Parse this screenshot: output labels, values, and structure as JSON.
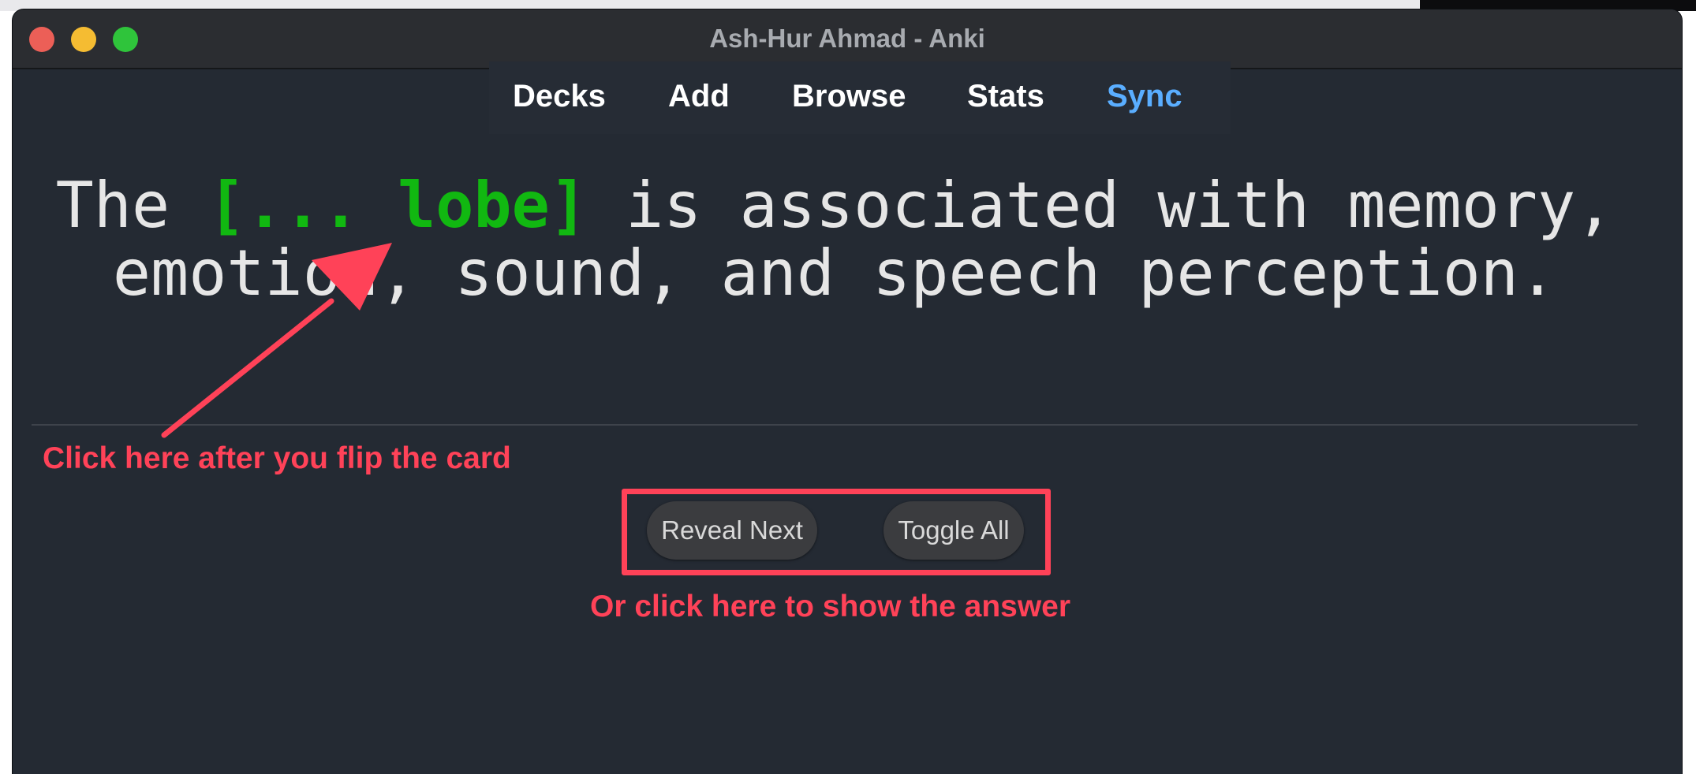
{
  "window": {
    "title": "Ash-Hur Ahmad - Anki"
  },
  "toolbar": {
    "items": [
      {
        "label": "Decks"
      },
      {
        "label": "Add"
      },
      {
        "label": "Browse"
      },
      {
        "label": "Stats"
      },
      {
        "label": "Sync"
      }
    ]
  },
  "card": {
    "line1_before": "The ",
    "cloze": "[... lobe]",
    "line1_after": " is associated with memory,",
    "line2": "emotion, sound, and speech perception."
  },
  "buttons": {
    "reveal_next": "Reveal Next",
    "toggle_all": "Toggle All"
  },
  "annotations": {
    "flip_hint": "Click here after you flip the card",
    "answer_hint": "Or click here to show the answer"
  },
  "colors": {
    "accent_sync": "#5aaeff",
    "cloze_green": "#11b811",
    "annotation_red": "#ff4258",
    "window_bg": "#242a33"
  }
}
